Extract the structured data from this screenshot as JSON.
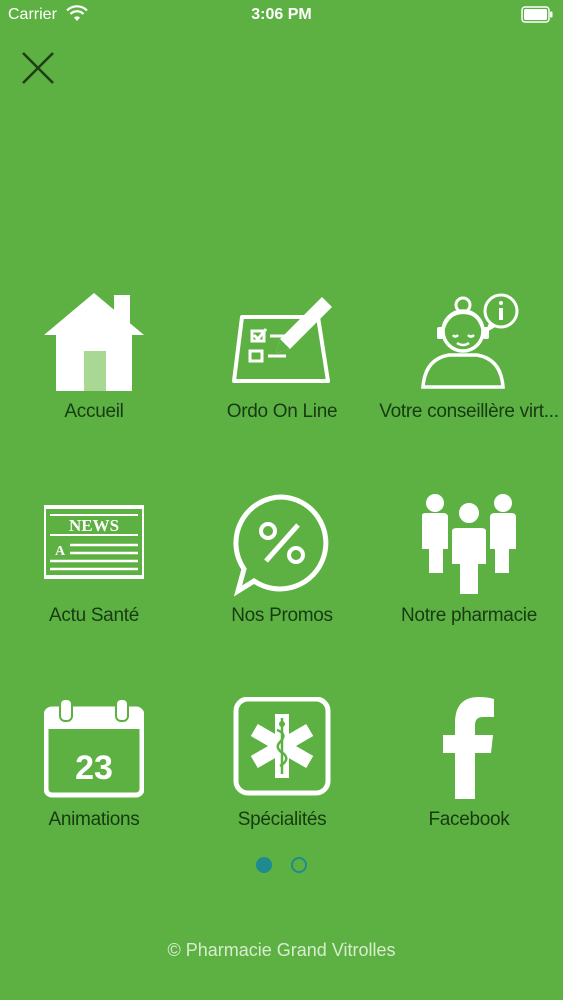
{
  "status": {
    "carrier": "Carrier",
    "time": "3:06 PM"
  },
  "menu": [
    {
      "label": "Accueil",
      "icon": "home-icon"
    },
    {
      "label": "Ordo On Line",
      "icon": "prescription-icon"
    },
    {
      "label": "Votre conseillère virt...",
      "icon": "advisor-icon"
    },
    {
      "label": "Actu Santé",
      "icon": "news-icon"
    },
    {
      "label": "Nos Promos",
      "icon": "promo-icon"
    },
    {
      "label": "Notre pharmacie",
      "icon": "team-icon"
    },
    {
      "label": "Animations",
      "icon": "calendar-icon"
    },
    {
      "label": "Spécialités",
      "icon": "medical-icon"
    },
    {
      "label": "Facebook",
      "icon": "facebook-icon"
    }
  ],
  "icon_text": {
    "news": "NEWS",
    "news_letter": "A",
    "calendar_day": "23"
  },
  "pager": {
    "pages": 2,
    "current": 1
  },
  "footer": "© Pharmacie Grand Vitrolles",
  "colors": {
    "background": "#5db142",
    "label": "#173b12",
    "pager": "#1e8c8e",
    "icon": "#ffffff"
  }
}
